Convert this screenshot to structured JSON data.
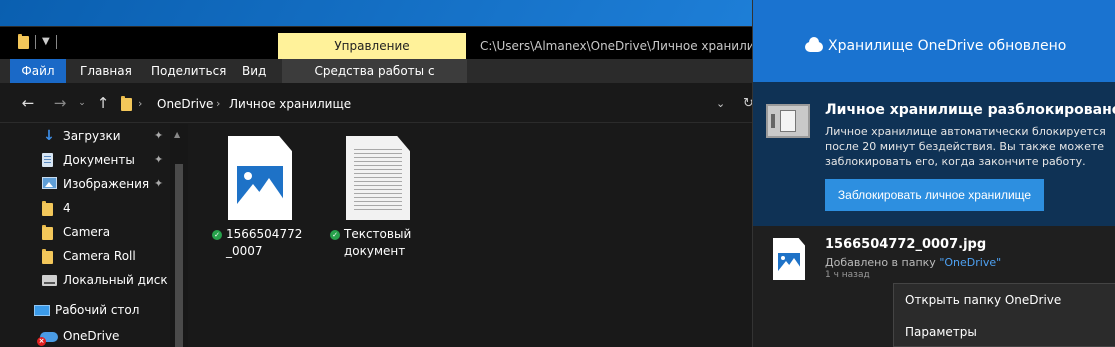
{
  "explorer": {
    "title_path": "C:\\Users\\Almanex\\OneDrive\\Личное хранилище",
    "context_tab": "Управление",
    "ribbon_tabs": {
      "file": "Файл",
      "home": "Главная",
      "share": "Поделиться",
      "view": "Вид",
      "picture_tools": "Средства работы с рисунками"
    },
    "breadcrumb": [
      "OneDrive",
      "Личное хранилище"
    ],
    "sidebar": [
      {
        "label": "Загрузки",
        "icon": "download-arrow-icon",
        "pinned": true
      },
      {
        "label": "Документы",
        "icon": "documents-icon",
        "pinned": true
      },
      {
        "label": "Изображения",
        "icon": "pictures-icon",
        "pinned": true
      },
      {
        "label": "4",
        "icon": "folder-icon",
        "pinned": false
      },
      {
        "label": "Camera",
        "icon": "folder-icon",
        "pinned": false
      },
      {
        "label": "Camera Roll",
        "icon": "folder-icon",
        "pinned": false
      },
      {
        "label": "Локальный диск (D",
        "icon": "drive-icon",
        "pinned": false
      },
      {
        "label": "Рабочий стол",
        "icon": "desktop-icon",
        "pinned": false
      },
      {
        "label": "OneDrive",
        "icon": "onedrive-cloud-icon",
        "pinned": false
      }
    ],
    "files": [
      {
        "name": "1566504772_0007",
        "type": "image",
        "sync_status": "synced"
      },
      {
        "name": "Текстовый документ",
        "type": "text",
        "sync_status": "synced"
      }
    ]
  },
  "onedrive": {
    "header_title": "Хранилище OneDrive обновлено",
    "unlock_title": "Личное хранилище разблокировано",
    "unlock_description": "Личное хранилище автоматически блокируется после 20 минут бездействия. Вы также можете заблокировать его, когда закончите работу.",
    "lock_button": "Заблокировать личное хранилище",
    "activity": {
      "file_name": "1566504772_0007.jpg",
      "added_prefix": "Добавлено в папку ",
      "folder_link": "\"OneDrive\"",
      "time": "1 ч назад"
    },
    "context_menu": {
      "open_folder": "Открыть папку OneDrive",
      "settings": "Параметры"
    }
  },
  "colors": {
    "accent": "#1a73d0",
    "unlock_panel": "#0f3255",
    "context_tab": "#fff29a",
    "synced": "#27a14b"
  }
}
